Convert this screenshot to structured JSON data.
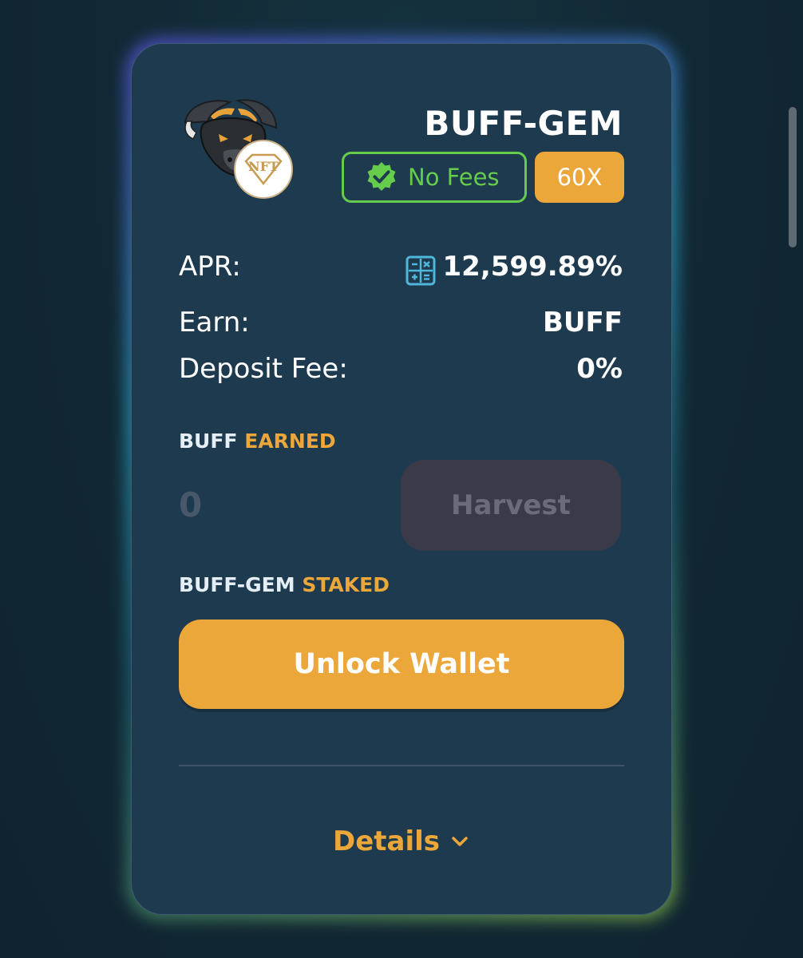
{
  "farm": {
    "title": "BUFF-GEM",
    "nft_badge_text": "NFT",
    "badges": {
      "no_fees": "No Fees",
      "multiplier": "60X"
    },
    "stats": {
      "apr_label": "APR:",
      "apr_value": "12,599.89%",
      "earn_label": "Earn:",
      "earn_value": "BUFF",
      "deposit_fee_label": "Deposit Fee:",
      "deposit_fee_value": "0%"
    },
    "earned": {
      "token": "BUFF",
      "suffix": "EARNED",
      "amount": "0",
      "harvest_label": "Harvest"
    },
    "staked": {
      "token": "BUFF-GEM",
      "suffix": "STAKED"
    },
    "unlock_label": "Unlock Wallet",
    "details_label": "Details"
  },
  "icons": {
    "verified": "check-badge-icon",
    "calculator": "calculator-icon",
    "chevron": "chevron-down-icon",
    "logo": "buffalo-logo"
  },
  "colors": {
    "background": "#112733",
    "card": "#1e3a4e",
    "accent_orange": "#eca73a",
    "accent_green": "#66cc4c",
    "calc_blue": "#4fb6dc",
    "harvest_disabled_bg": "#3b3a48",
    "harvest_disabled_text": "#6c6b7b"
  }
}
